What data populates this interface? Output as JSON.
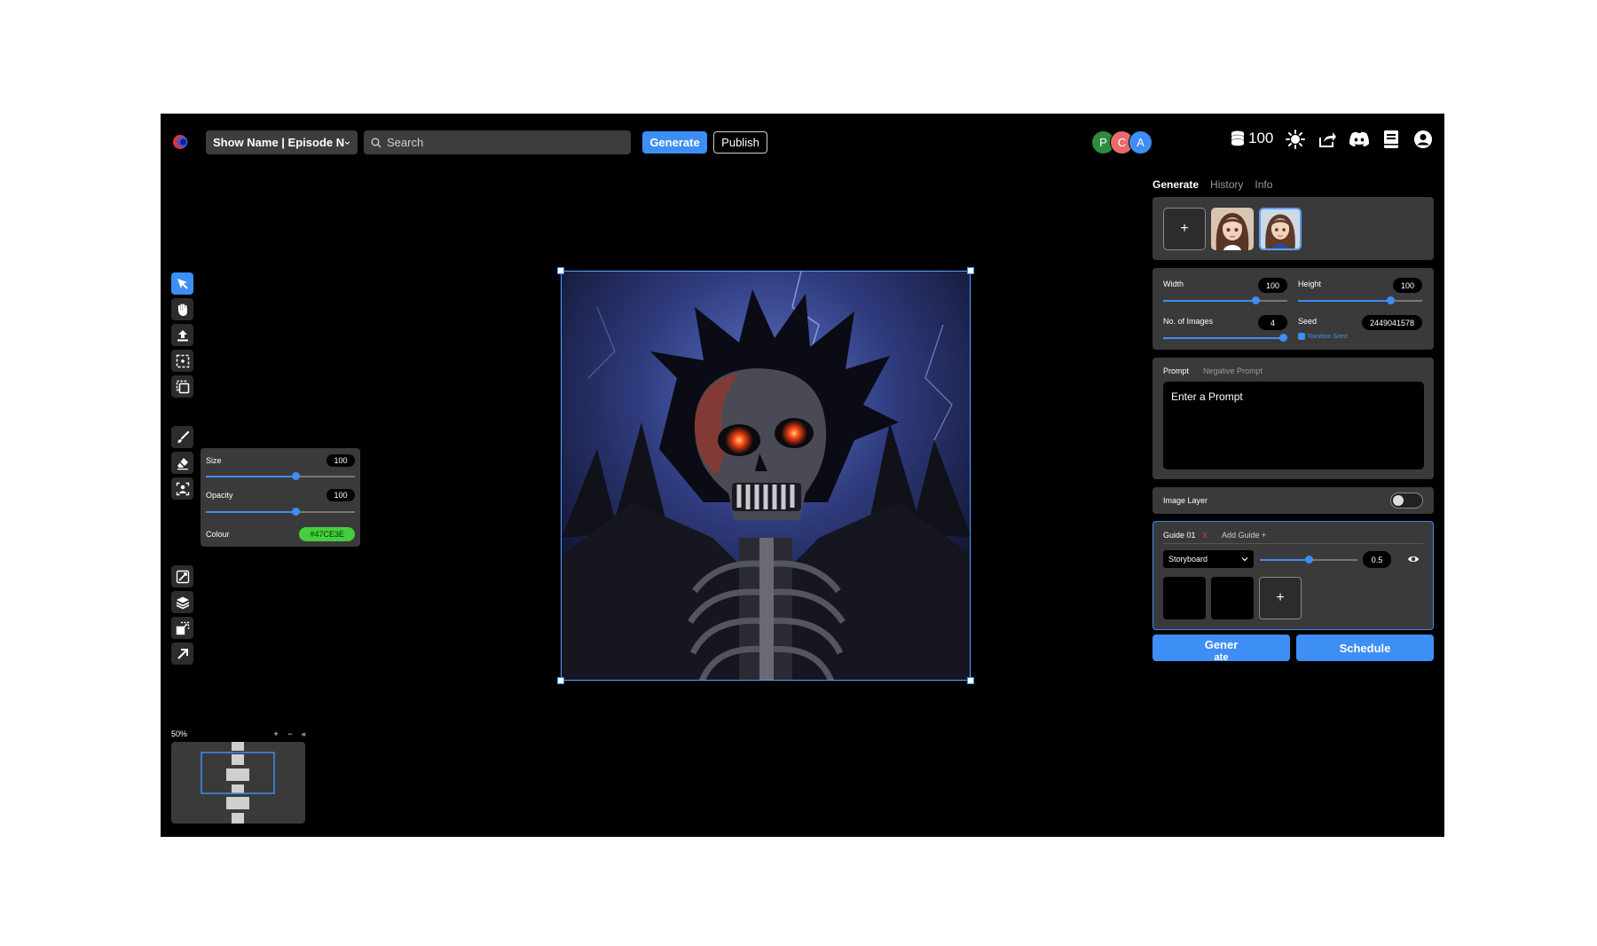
{
  "header": {
    "show_select": "Show Name  |  Episode N",
    "search_placeholder": "Search",
    "generate_label": "Generate",
    "publish_label": "Publish",
    "collaborators": [
      {
        "initial": "P",
        "color": "#2e8b3e"
      },
      {
        "initial": "C",
        "color": "#e86a6a"
      },
      {
        "initial": "A",
        "color": "#3d8ef5"
      }
    ],
    "credits": "100"
  },
  "brush": {
    "size_label": "Size",
    "size_value": "100",
    "size_level": 0.6,
    "opacity_label": "Opacity",
    "opacity_value": "100",
    "opacity_level": 0.6,
    "colour_label": "Colour",
    "colour_value": "#47CE3E"
  },
  "minimap": {
    "zoom": "50%",
    "plus": "+",
    "minus": "−",
    "collapse": "«"
  },
  "panel": {
    "tabs": [
      {
        "label": "Generate",
        "active": true
      },
      {
        "label": "History",
        "active": false
      },
      {
        "label": "Info",
        "active": false
      }
    ],
    "add_ref": "+",
    "width_label": "Width",
    "width_value": "100",
    "height_label": "Height",
    "height_value": "100",
    "images_label": "No. of Images",
    "images_value": "4",
    "seed_label": "Seed",
    "seed_value": "2449041578",
    "random_seed_label": "Random Seed",
    "prompt_tab": "Prompt",
    "negative_prompt_tab": "Negative Prompt",
    "prompt_placeholder": "Enter a Prompt",
    "image_layer_label": "Image Layer",
    "guide_label": "Guide 01",
    "guide_remove": "X",
    "add_guide": "Add Guide +",
    "guide_type": "Storyboard",
    "guide_strength": "0.5",
    "guide_add": "+",
    "generate_btn_line1": "Gener",
    "generate_btn_line2": "ate",
    "schedule_btn": "Schedule"
  }
}
